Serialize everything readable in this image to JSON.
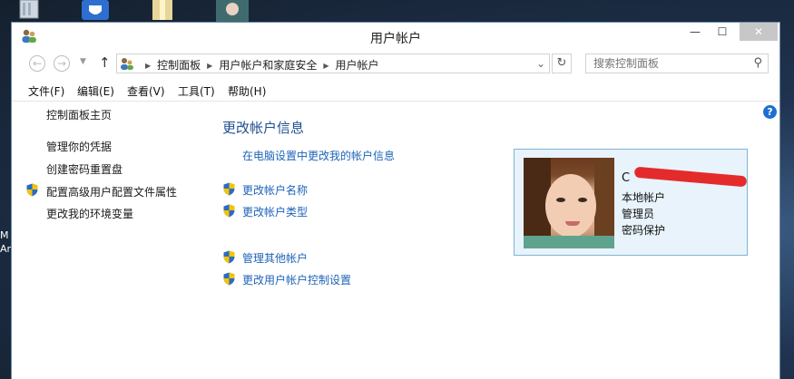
{
  "desktop": {
    "side_text": "M\nAr"
  },
  "window": {
    "title": "用户帐户",
    "controls": {
      "minimize": "—",
      "maximize": "☐",
      "close": "✕"
    }
  },
  "nav": {
    "back": "←",
    "forward": "→",
    "up": "↑",
    "breadcrumb": [
      "控制面板",
      "用户帐户和家庭安全",
      "用户帐户"
    ],
    "refresh": "↻",
    "search_placeholder": "搜索控制面板"
  },
  "menu": [
    "文件(F)",
    "编辑(E)",
    "查看(V)",
    "工具(T)",
    "帮助(H)"
  ],
  "sidebar": {
    "home": "控制面板主页",
    "items": [
      {
        "label": "管理你的凭据",
        "shield": false
      },
      {
        "label": "创建密码重置盘",
        "shield": false
      },
      {
        "label": "配置高级用户配置文件属性",
        "shield": true
      },
      {
        "label": "更改我的环境变量",
        "shield": false
      }
    ]
  },
  "main": {
    "heading": "更改帐户信息",
    "pc_settings_link": "在电脑设置中更改我的帐户信息",
    "links_group1": [
      {
        "label": "更改帐户名称",
        "shield": true
      },
      {
        "label": "更改帐户类型",
        "shield": true
      }
    ],
    "links_group2": [
      {
        "label": "管理其他帐户",
        "shield": true
      },
      {
        "label": "更改用户帐户控制设置",
        "shield": true
      }
    ]
  },
  "account": {
    "name": "C",
    "type_local": "本地帐户",
    "role": "管理员",
    "password": "密码保护"
  },
  "colors": {
    "link": "#1e63b8",
    "heading": "#1f4e91",
    "card_bg": "#e8f3fb",
    "card_border": "#7fb3d5"
  }
}
